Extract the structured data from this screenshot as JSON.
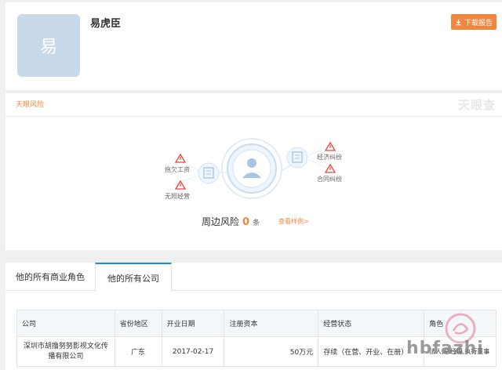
{
  "profile": {
    "avatar_char": "易",
    "name": "易虎臣",
    "download_label": "下载报告"
  },
  "risk": {
    "title": "天眼风险",
    "brand": "天眼查",
    "left_items": [
      "拖欠工资",
      "无照经营"
    ],
    "right_items": [
      "经济纠纷",
      "合同纠纷"
    ],
    "summary_label": "周边风险",
    "summary_count": "0",
    "summary_unit": "条",
    "view_example": "查看样例>"
  },
  "tabs": [
    {
      "label": "他的所有商业角色",
      "active": false
    },
    {
      "label": "他的所有公司",
      "active": true
    }
  ],
  "table": {
    "headers": [
      "公司",
      "省份地区",
      "开业日期",
      "注册资本",
      "经营状态",
      "角色"
    ],
    "rows": [
      {
        "company": "深圳市胡撸努努影视文化传播有限公司",
        "region": "广东",
        "date": "2017-02-17",
        "capital": "50万元",
        "status": "存续（在营、开业、在册）",
        "role": "法人,总经理,执行董事"
      }
    ]
  },
  "watermark": "hbfazhi",
  "colors": {
    "accent": "#f0873e",
    "link": "#128bed",
    "status_ok": "#3fad5a",
    "warning": "#e8453c"
  }
}
